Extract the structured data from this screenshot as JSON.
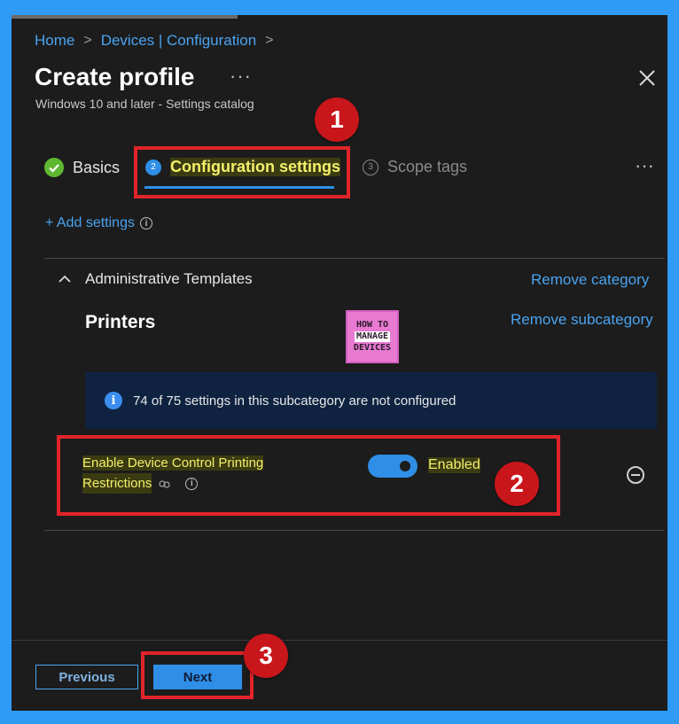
{
  "breadcrumb": {
    "home": "Home",
    "devices": "Devices | Configuration",
    "sep": ">"
  },
  "header": {
    "title": "Create profile",
    "more": "···",
    "subtitle": "Windows 10 and later - Settings catalog"
  },
  "steps": [
    {
      "label": "Basics",
      "state": "complete"
    },
    {
      "number": "2",
      "label": "Configuration settings",
      "state": "current"
    },
    {
      "number": "3",
      "label": "Scope tags",
      "state": "pending"
    }
  ],
  "steps_more": "···",
  "add_settings": {
    "label": "+ Add settings",
    "info": "i"
  },
  "category": {
    "chevron": "^",
    "name": "Administrative Templates",
    "remove_category": "Remove category",
    "subcategory": "Printers",
    "remove_subcategory": "Remove subcategory"
  },
  "logo": {
    "line1": "HOW TO",
    "line2": "MANAGE",
    "line3": "DEVICES"
  },
  "banner": {
    "info": "i",
    "text": "74 of 75 settings in this subcategory are not configured"
  },
  "setting": {
    "name_line1": "Enable Device Control Printing",
    "name_line2": "Restrictions",
    "toggle_label": "Enabled",
    "toggle_on": true
  },
  "callouts": {
    "one": "1",
    "two": "2",
    "three": "3"
  },
  "footer": {
    "previous": "Previous",
    "next": "Next"
  },
  "colors": {
    "accent": "#4aa3f0",
    "callout": "#c8161b",
    "highlight": "#f3f06a",
    "page_bg": "#2f9bf4"
  }
}
